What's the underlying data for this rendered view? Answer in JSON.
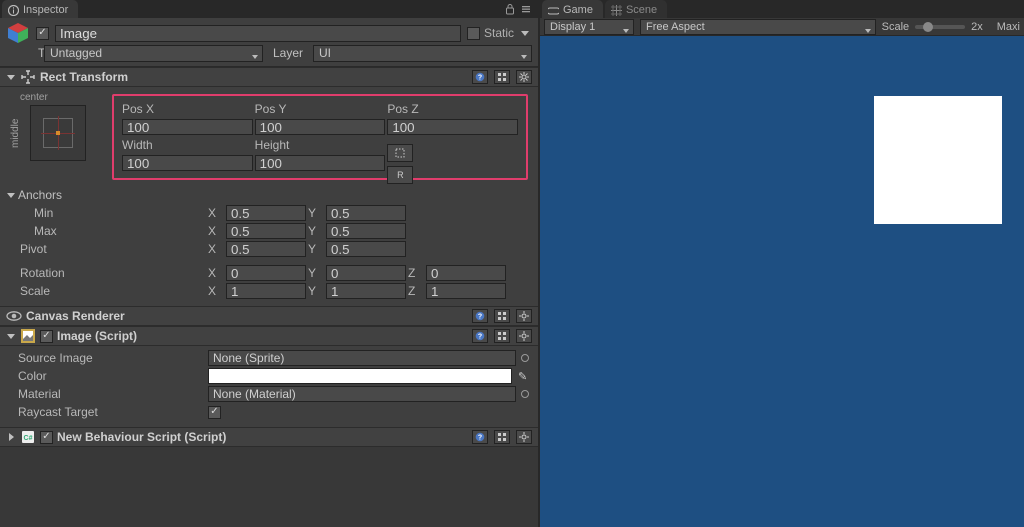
{
  "tabs": {
    "inspector": "Inspector",
    "game": "Game",
    "scene": "Scene"
  },
  "gameToolbar": {
    "display": "Display 1",
    "aspect": "Free Aspect",
    "scaleLabel": "Scale",
    "scaleValue": "2x",
    "maxLabel": "Maxi"
  },
  "gameObject": {
    "name": "Image",
    "staticLabel": "Static",
    "tagLabel": "Tag",
    "tagValue": "Untagged",
    "layerLabel": "Layer",
    "layerValue": "UI"
  },
  "rectTransform": {
    "title": "Rect Transform",
    "centerLabel": "center",
    "middleLabel": "middle",
    "posX": {
      "label": "Pos X",
      "value": "100"
    },
    "posY": {
      "label": "Pos Y",
      "value": "100"
    },
    "posZ": {
      "label": "Pos Z",
      "value": "100"
    },
    "width": {
      "label": "Width",
      "value": "100"
    },
    "height": {
      "label": "Height",
      "value": "100"
    },
    "blueprintBtn": "⊡",
    "rawBtn": "R",
    "anchorsLabel": "Anchors",
    "minLabel": "Min",
    "maxLabel": "Max",
    "pivotLabel": "Pivot",
    "rotationLabel": "Rotation",
    "scaleLabel": "Scale",
    "min": {
      "x": "0.5",
      "y": "0.5"
    },
    "max": {
      "x": "0.5",
      "y": "0.5"
    },
    "pivot": {
      "x": "0.5",
      "y": "0.5"
    },
    "rotation": {
      "x": "0",
      "y": "0",
      "z": "0"
    },
    "scale": {
      "x": "1",
      "y": "1",
      "z": "1"
    },
    "xLabel": "X",
    "yLabel": "Y",
    "zLabel": "Z"
  },
  "canvasRenderer": {
    "title": "Canvas Renderer"
  },
  "image": {
    "title": "Image (Script)",
    "sourceImageLabel": "Source Image",
    "sourceImageValue": "None (Sprite)",
    "colorLabel": "Color",
    "materialLabel": "Material",
    "materialValue": "None (Material)",
    "raycastLabel": "Raycast Target"
  },
  "newBehaviour": {
    "title": "New Behaviour Script (Script)"
  }
}
